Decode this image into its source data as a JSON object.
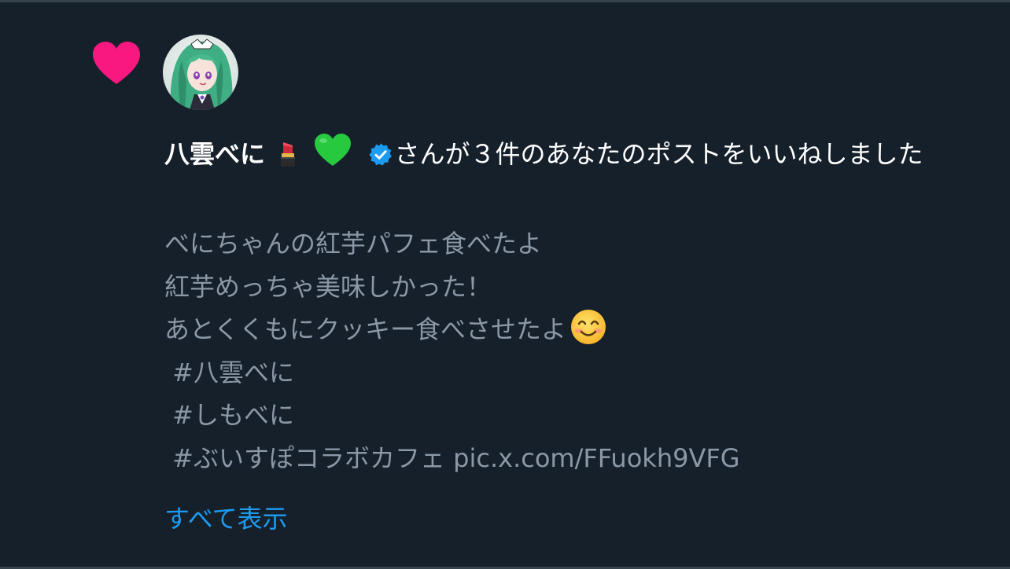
{
  "notification": {
    "user_name": "八雲べに",
    "user_emojis": [
      "lipstick",
      "green-heart"
    ],
    "verified": true,
    "action_text": "さんが３件のあなたのポストをいいねしました",
    "post_lines": [
      "べにちゃんの紅芋パフェ食べたよ",
      "紅芋めっちゃ美味しかった！",
      "あとくくもにクッキー食べさせたよ",
      " #八雲べに",
      " #しもべに",
      " #ぶいすぽコラボカフェ pic.x.com/FFuokh9VFG"
    ],
    "post_trailing_emoji": "smiling-face-emoji",
    "show_all_label": "すべて表示"
  },
  "colors": {
    "background": "#15202b",
    "heart": "#f91880",
    "name_text": "#ffffff",
    "post_text": "#8b98a5",
    "link": "#1d9bf0",
    "verified": "#1d9bf0",
    "divider": "#38444d"
  }
}
